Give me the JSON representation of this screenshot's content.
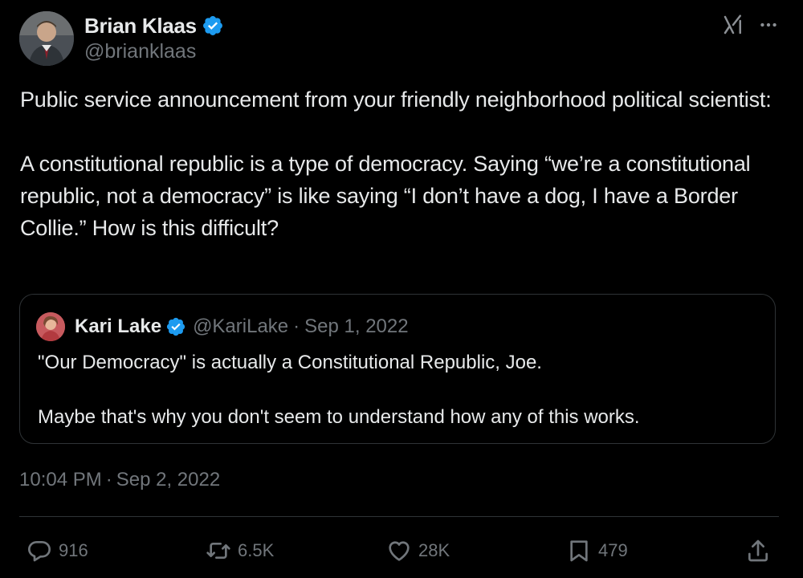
{
  "tweet": {
    "author_name": "Brian Klaas",
    "author_handle": "@brianklaas",
    "text_line1": "Public service announcement from your friendly neighborhood political scientist:",
    "text_line2": "A constitutional republic is a type of democracy. Saying “we’re a constitutional republic, not a democracy” is like saying “I don’t have a dog, I have a Border Collie.” How is this difficult?",
    "time": "10:04 PM",
    "date_sep": "·",
    "date": "Sep 2, 2022"
  },
  "quoted": {
    "author_name": "Kari Lake",
    "author_handle": "@KariLake",
    "sep": "·",
    "date": "Sep 1, 2022",
    "text_line1": "\"Our Democracy\" is actually a Constitutional Republic, Joe.",
    "text_line2": "Maybe that's why you don't seem to understand how any of this works."
  },
  "metrics": {
    "replies": "916",
    "reposts": "6.5K",
    "likes": "28K",
    "bookmarks": "479"
  },
  "icons": {
    "verified": "verified-badge-icon",
    "grok": "grok-icon",
    "more": "more-dots-icon",
    "reply": "reply-icon",
    "repost": "repost-icon",
    "like": "heart-icon",
    "bookmark": "bookmark-icon",
    "share": "share-icon"
  },
  "colors": {
    "background": "#000000",
    "text_primary": "#e7e9ea",
    "text_secondary": "#71767b",
    "verified_blue": "#1d9bf0",
    "border": "#2f3336"
  }
}
